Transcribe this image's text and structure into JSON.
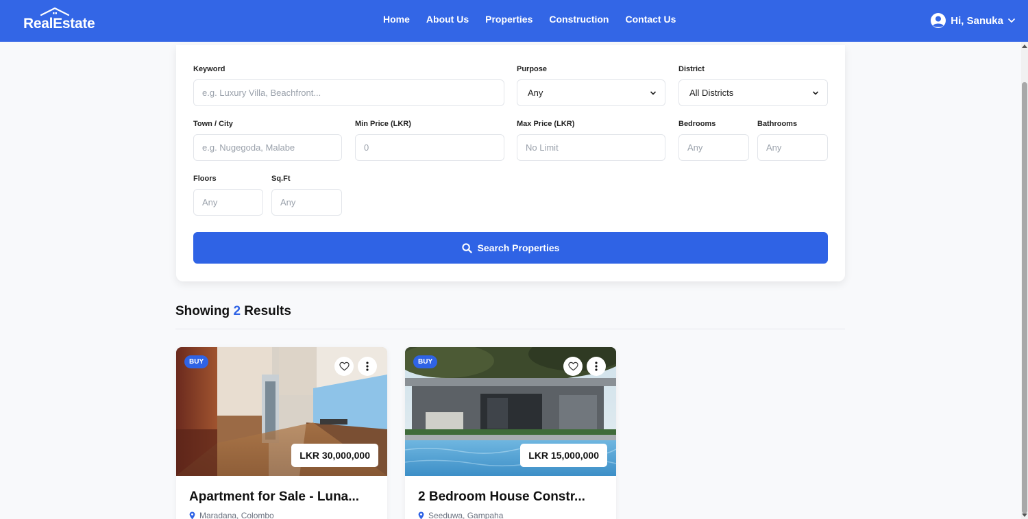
{
  "nav": {
    "brand": "RealEstate",
    "links": [
      "Home",
      "About Us",
      "Properties",
      "Construction",
      "Contact Us"
    ],
    "user_greeting": "Hi, Sanuka"
  },
  "search": {
    "keyword_label": "Keyword",
    "keyword_placeholder": "e.g. Luxury Villa, Beachfront...",
    "purpose_label": "Purpose",
    "purpose_value": "Any",
    "district_label": "District",
    "district_value": "All Districts",
    "town_label": "Town / City",
    "town_placeholder": "e.g. Nugegoda, Malabe",
    "min_price_label": "Min Price (LKR)",
    "min_price_placeholder": "0",
    "max_price_label": "Max Price (LKR)",
    "max_price_placeholder": "No Limit",
    "bedrooms_label": "Bedrooms",
    "bedrooms_placeholder": "Any",
    "bathrooms_label": "Bathrooms",
    "bathrooms_placeholder": "Any",
    "floors_label": "Floors",
    "floors_placeholder": "Any",
    "sqft_label": "Sq.Ft",
    "sqft_placeholder": "Any",
    "button_label": "Search Properties"
  },
  "results": {
    "prefix": "Showing",
    "count": "2",
    "suffix": "Results"
  },
  "listings": [
    {
      "badge": "BUY",
      "price": "LKR 30,000,000",
      "title": "Apartment for Sale - Luna...",
      "location": "Maradana, Colombo"
    },
    {
      "badge": "BUY",
      "price": "LKR 15,000,000",
      "title": "2 Bedroom House Constr...",
      "location": "Seeduwa, Gampaha"
    }
  ],
  "colors": {
    "primary": "#3366e6",
    "button": "#2f63e5",
    "background": "#f8f9fb"
  }
}
